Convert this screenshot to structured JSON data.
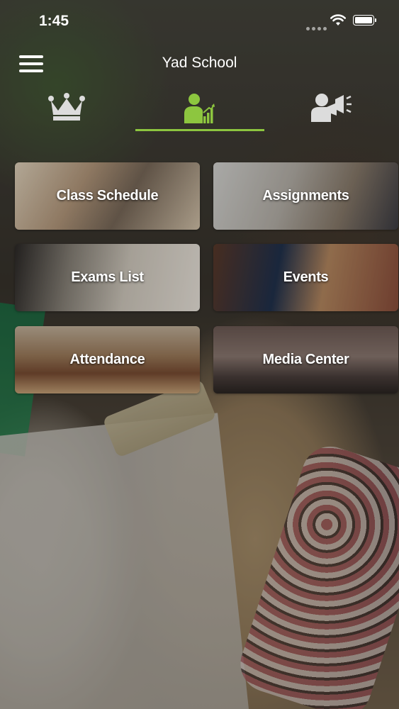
{
  "status_bar": {
    "time": "1:45"
  },
  "header": {
    "title": "Yad School"
  },
  "tabs": [
    {
      "icon": "crown-icon",
      "active": false
    },
    {
      "icon": "teacher-chart-icon",
      "active": true
    },
    {
      "icon": "announcement-megaphone-icon",
      "active": false
    }
  ],
  "colors": {
    "accent": "#8dc63f",
    "text": "#ffffff",
    "inactive_icon": "#dcdcdc"
  },
  "menu": [
    {
      "label": "Class Schedule"
    },
    {
      "label": "Assignments"
    },
    {
      "label": "Exams List"
    },
    {
      "label": "Events"
    },
    {
      "label": "Attendance"
    },
    {
      "label": "Media Center"
    }
  ]
}
